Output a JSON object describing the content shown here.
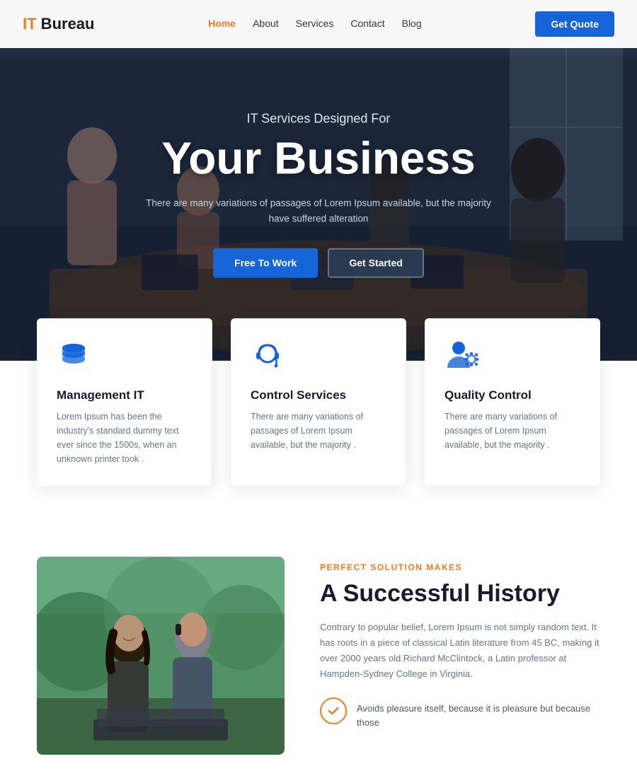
{
  "brand": {
    "name_part1": "IT",
    "name_part2": " Bureau"
  },
  "navbar": {
    "links": [
      {
        "label": "Home",
        "active": true
      },
      {
        "label": "About",
        "active": false
      },
      {
        "label": "Services",
        "active": false
      },
      {
        "label": "Contact",
        "active": false
      },
      {
        "label": "Blog",
        "active": false
      }
    ],
    "cta_label": "Get Quote"
  },
  "hero": {
    "subtitle": "IT Services Designed For",
    "title": "Your Business",
    "description": "There are many variations of passages of Lorem Ipsum available, but the majority have suffered alteration",
    "btn_primary": "Free To Work",
    "btn_secondary": "Get Started"
  },
  "services": [
    {
      "title": "Management IT",
      "description": "Lorem Ipsum has been the industry's standard dummy text ever since the 1500s, when an unknown printer took ."
    },
    {
      "title": "Control Services",
      "description": "There are many variations of passages of Lorem Ipsum available, but the majority ."
    },
    {
      "title": "Quality Control",
      "description": "There are many variations of passages of Lorem Ipsum available, but the majority ."
    }
  ],
  "about": {
    "tag": "PERFECT SOLUTION MAKES",
    "title": "A Successful History",
    "description": "Contrary to popular belief, Lorem Ipsum is not simply random text. It has roots in a piece of classical Latin literature from 45 BC, making it over 2000 years old.Richard McClintock, a Latin professor at Hampden-Sydney College in Virginia.",
    "check_text": "Avoids pleasure itself, because it is pleasure but because those"
  }
}
